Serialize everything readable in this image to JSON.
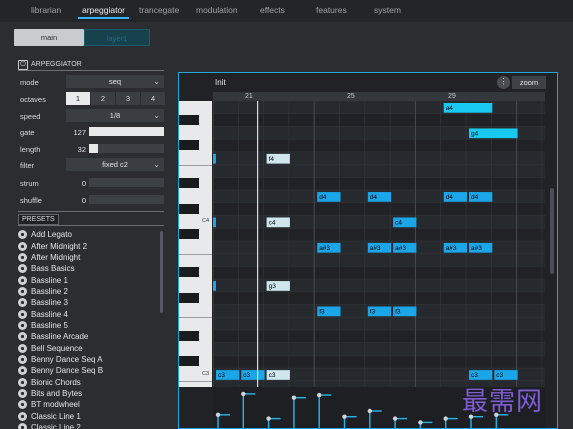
{
  "nav": {
    "tabs": [
      {
        "label": "librarian"
      },
      {
        "label": "arpeggiator"
      },
      {
        "label": "trancegate"
      },
      {
        "label": "modulation"
      },
      {
        "label": "effects"
      },
      {
        "label": "features"
      },
      {
        "label": "system"
      }
    ],
    "active_tab": "arpeggiator"
  },
  "layers": {
    "main_label": "main",
    "layer_label": "layer1"
  },
  "arpeggiator": {
    "section_title": "ARPEGGIATOR",
    "mode": {
      "label": "mode",
      "value": "seq"
    },
    "octaves": {
      "label": "octaves",
      "options": [
        "1",
        "2",
        "3",
        "4"
      ],
      "selected": "1"
    },
    "speed": {
      "label": "speed",
      "value": "1/8"
    },
    "gate": {
      "label": "gate",
      "value": "127",
      "fraction": 1.0
    },
    "length": {
      "label": "length",
      "value": "32",
      "fraction": 0.12
    },
    "filter": {
      "label": "filter",
      "value": "fixed c2"
    },
    "strum": {
      "label": "strum",
      "value": "0",
      "fraction": 0
    },
    "shuffle": {
      "label": "shuffle",
      "value": "0",
      "fraction": 0
    }
  },
  "presets": {
    "section_title": "PRESETS",
    "items": [
      "Add Legato",
      "After Midnight 2",
      "After Midnight",
      "Bass Basics",
      "Bassline 1",
      "Bassline 2",
      "Bassline 3",
      "Bassline 4",
      "Bassline 5",
      "Bassline Arcade",
      "Bell Sequence",
      "Benny Dance Seq A",
      "Benny Dance Seq B",
      "Bionic Chords",
      "Bits and Bytes",
      "BT modwheel",
      "Classic Line 1",
      "Classic Line 2"
    ]
  },
  "roll": {
    "title": "Init",
    "zoom_label": "zoom",
    "more_label": "⋮",
    "ruler_marks": [
      "21",
      "25",
      "29"
    ],
    "octave_labels": [
      "C4",
      "C3"
    ],
    "accent_color": "#1ea6dd",
    "note_colors": {
      "bright": "#19c9f2",
      "mid": "#1aa6e8",
      "dark": "#1b62d6",
      "selected": "#cfe6ee"
    }
  },
  "sequence": {
    "notes": [
      {
        "step": 0,
        "pitch": "c3",
        "len": 1,
        "vel": 1
      },
      {
        "step": 1,
        "pitch": "c3",
        "len": 1,
        "vel": 1
      },
      {
        "step": 2,
        "pitch": "c3",
        "len": 1,
        "vel": 1,
        "selected": true
      },
      {
        "step": 2,
        "pitch": "g3",
        "len": 1,
        "vel": 1,
        "selected": true
      },
      {
        "step": 2,
        "pitch": "c4",
        "len": 1,
        "vel": 1,
        "selected": true
      },
      {
        "step": 2,
        "pitch": "f4",
        "len": 1,
        "vel": 1,
        "selected": true
      },
      {
        "step": 3,
        "pitch": "a#2",
        "len": 1,
        "vel": 1
      },
      {
        "step": 4,
        "pitch": "d4",
        "len": 1,
        "vel": 1
      },
      {
        "step": 4,
        "pitch": "a#3",
        "len": 1,
        "vel": 1
      },
      {
        "step": 4,
        "pitch": "f3",
        "len": 1,
        "vel": 1
      },
      {
        "step": 6,
        "pitch": "d4",
        "len": 1,
        "vel": 1
      },
      {
        "step": 6,
        "pitch": "a#3",
        "len": 1,
        "vel": 1
      },
      {
        "step": 6,
        "pitch": "f3",
        "len": 1,
        "vel": 1
      },
      {
        "step": 6,
        "pitch": "a#2",
        "len": 1,
        "vel": 1
      },
      {
        "step": 7,
        "pitch": "c4",
        "len": 1,
        "vel": 1
      },
      {
        "step": 7,
        "pitch": "a#3",
        "len": 1,
        "vel": 1
      },
      {
        "step": 7,
        "pitch": "f3",
        "len": 1,
        "vel": 1
      },
      {
        "step": 7,
        "pitch": "a#2",
        "len": 1,
        "vel": 1
      },
      {
        "step": 9,
        "pitch": "a4",
        "len": 2,
        "vel": 1
      },
      {
        "step": 9,
        "pitch": "d4",
        "len": 1,
        "vel": 1
      },
      {
        "step": 9,
        "pitch": "a#3",
        "len": 1,
        "vel": 1
      },
      {
        "step": 9,
        "pitch": "a#2",
        "len": 1,
        "vel": 1
      },
      {
        "step": 10,
        "pitch": "g4",
        "len": 2,
        "vel": 1
      },
      {
        "step": 10,
        "pitch": "d4",
        "len": 1,
        "vel": 1
      },
      {
        "step": 10,
        "pitch": "a#3",
        "len": 1,
        "vel": 1
      },
      {
        "step": 10,
        "pitch": "c3",
        "len": 1,
        "vel": 1
      },
      {
        "step": 11,
        "pitch": "c3",
        "len": 1,
        "vel": 1
      }
    ],
    "velocity": [
      0.4,
      0.95,
      0.3,
      0.85,
      0.92,
      0.35,
      0.5,
      0.3,
      0.2,
      0.3,
      0.35,
      0.4
    ]
  },
  "watermark": "最需网"
}
